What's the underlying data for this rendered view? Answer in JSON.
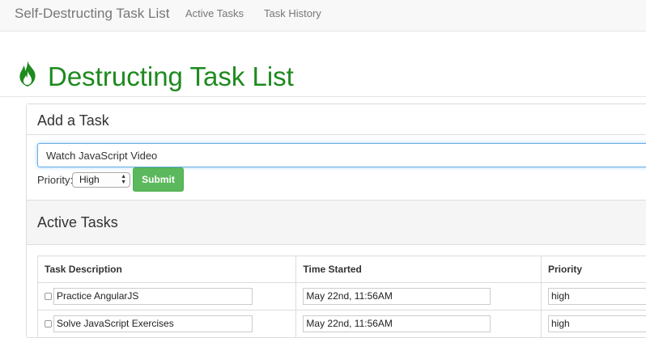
{
  "navbar": {
    "brand": "Self-Destructing Task List",
    "links": [
      "Active Tasks",
      "Task History"
    ]
  },
  "header": {
    "title": "Destructing Task List",
    "icon": "fire-icon",
    "accent_color": "#1e8a1e"
  },
  "add_task": {
    "heading": "Add a Task",
    "input_value": "Watch JavaScript Video",
    "priority_label": "Priority:",
    "priority_selected": "High",
    "submit_label": "Submit",
    "submit_color": "#5cb85c"
  },
  "active_tasks": {
    "heading": "Active Tasks",
    "columns": [
      "Task Description",
      "Time Started",
      "Priority"
    ],
    "rows": [
      {
        "description": "Practice AngularJS",
        "time": "May 22nd, 11:56AM",
        "priority": "high"
      },
      {
        "description": "Solve JavaScript Exercises",
        "time": "May 22nd, 11:56AM",
        "priority": "high"
      }
    ]
  }
}
